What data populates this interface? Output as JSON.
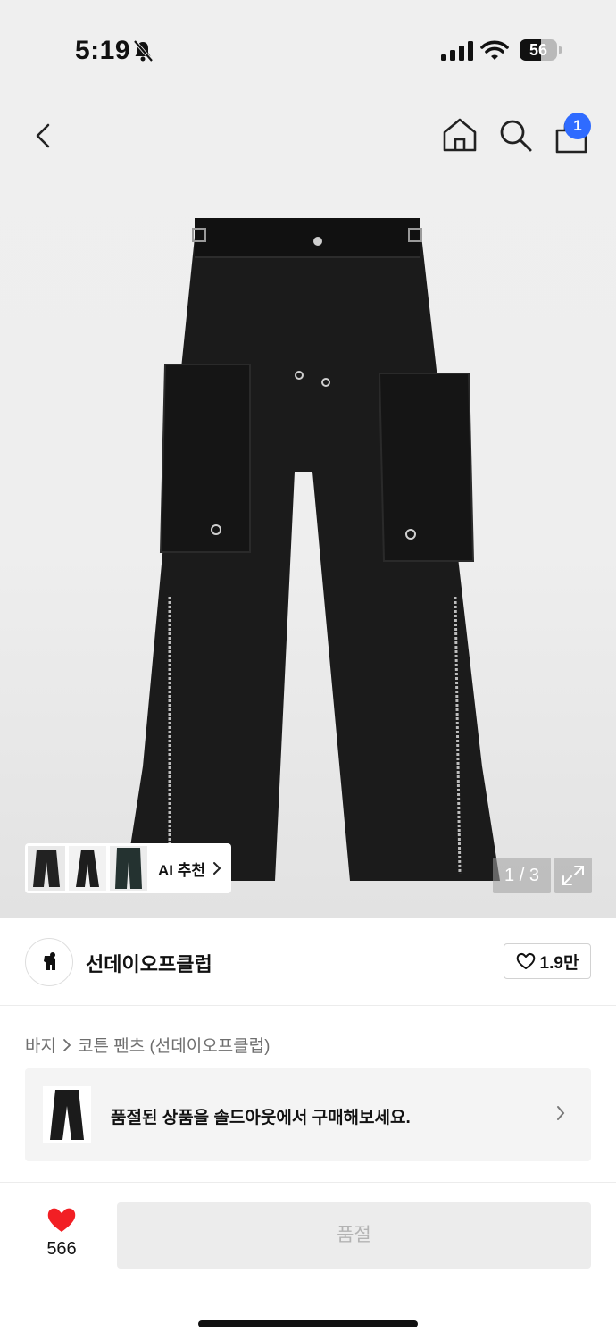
{
  "status_bar": {
    "time": "5:19",
    "battery_level": "56",
    "battery_fraction": 0.56,
    "icons": [
      "bell-slash-icon",
      "signal-icon",
      "wifi-icon",
      "battery-icon"
    ]
  },
  "nav": {
    "icons": [
      "back-icon",
      "home-icon",
      "search-icon",
      "bag-icon"
    ],
    "cart_count": "1"
  },
  "gallery": {
    "ai_recommend_label": "AI 추천",
    "page_counter": "1 / 3",
    "current_page": 1,
    "total_pages": 3
  },
  "brand": {
    "name": "선데이오프클럽",
    "like_count": "1.9만"
  },
  "breadcrumb": {
    "category": "바지",
    "product": "코튼 팬츠 (선데이오프클럽)"
  },
  "soldout_promo": {
    "text": "품절된 상품을 솔드아웃에서 구매해보세요."
  },
  "bottom_bar": {
    "wish_count": "566",
    "status_button": "품절"
  },
  "colors": {
    "accent_blue": "#2f6bff",
    "heart_red": "#f21f24",
    "disabled_gray": "#ececec"
  }
}
